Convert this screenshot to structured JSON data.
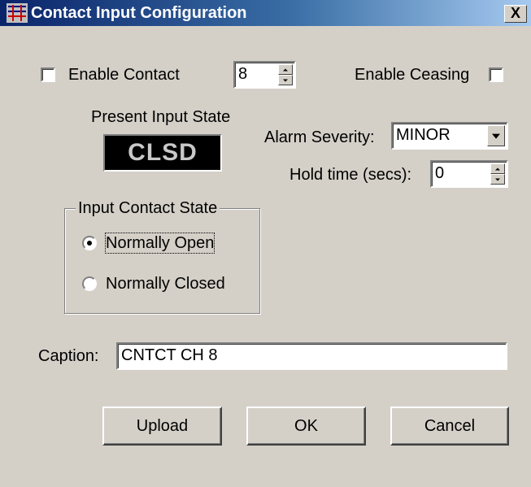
{
  "window": {
    "title": "Contact Input Configuration",
    "close_label": "X"
  },
  "enable_contact": {
    "label": "Enable Contact",
    "checked": false
  },
  "channel_spinner": {
    "value": "8"
  },
  "enable_ceasing": {
    "label": "Enable Ceasing",
    "checked": false
  },
  "present_state": {
    "label": "Present Input State",
    "value": "CLSD"
  },
  "alarm_severity": {
    "label": "Alarm Severity:",
    "value": "MINOR"
  },
  "hold_time": {
    "label": "Hold time (secs):",
    "value": "0"
  },
  "contact_state_group": {
    "title": "Input Contact State",
    "options": [
      {
        "label": "Normally Open",
        "selected": true
      },
      {
        "label": "Normally Closed",
        "selected": false
      }
    ]
  },
  "caption": {
    "label": "Caption:",
    "value": "CNTCT CH 8"
  },
  "buttons": {
    "upload": "Upload",
    "ok": "OK",
    "cancel": "Cancel"
  },
  "colors": {
    "title_start": "#0a246a",
    "title_end": "#a6caf0",
    "face": "#d4d0c8",
    "state_bg": "#000000",
    "state_fg": "#c8c8c8"
  }
}
